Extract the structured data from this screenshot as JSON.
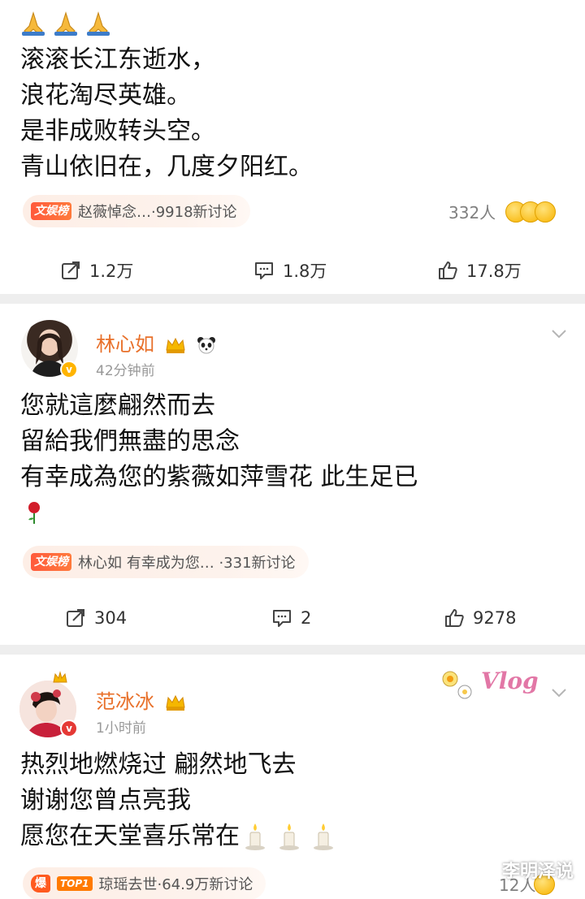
{
  "post1": {
    "lines": [
      "滚滚长江东逝水，",
      "浪花淘尽英雄。",
      "是非成败转头空。",
      "青山依旧在，几度夕阳红。"
    ],
    "topic_tag": "文娱榜",
    "topic_text": "赵薇悼念…·9918新讨论",
    "reaction_count": "332人",
    "actions": {
      "repost": "1.2万",
      "comment": "1.8万",
      "like": "17.8万"
    }
  },
  "post2": {
    "name": "林心如",
    "time": "42分钟前",
    "lines": [
      "您就這麼翩然而去",
      "留給我們無盡的思念",
      "有幸成為您的紫薇如萍雪花  此生足已"
    ],
    "topic_tag": "文娱榜",
    "topic_text": "林心如 有幸成为您… ·331新讨论",
    "actions": {
      "repost": "304",
      "comment": "2",
      "like": "9278"
    }
  },
  "post3": {
    "name": "范冰冰",
    "time": "1小时前",
    "lines": [
      "热烈地燃烧过  翩然地飞去",
      "谢谢您曾点亮我",
      "愿您在天堂喜乐常在"
    ],
    "topic_tag": "爆",
    "topic_top": "TOP1",
    "topic_text": "琼瑶去世·64.9万新讨论",
    "reaction_count": "12人",
    "sticker": "Vlog"
  },
  "watermark": "李明泽说",
  "colors": {
    "name": "#e8702a",
    "chip_bg": "#fdeee6",
    "divider": "#eeeeee",
    "gray_text": "#999999"
  }
}
